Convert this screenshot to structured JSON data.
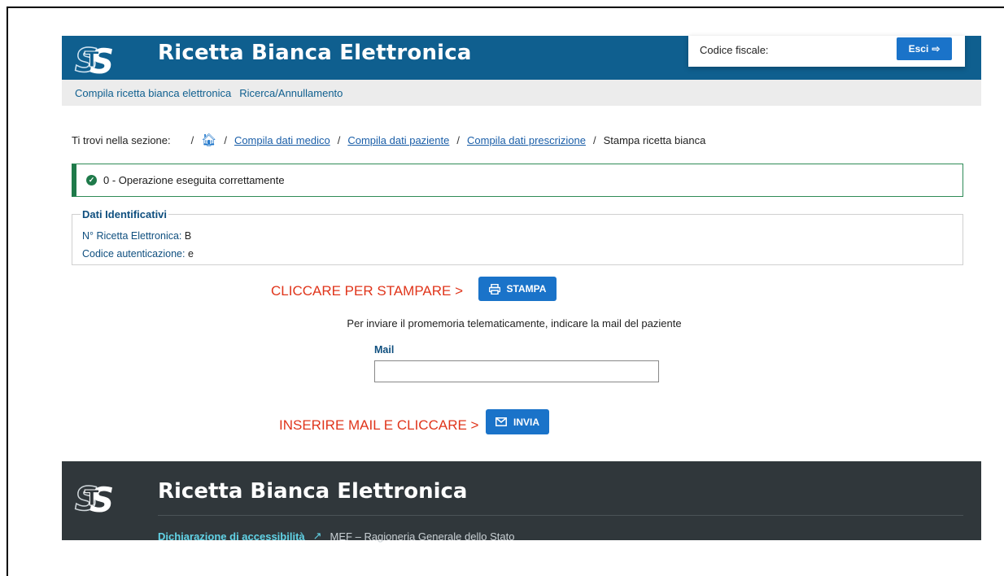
{
  "header": {
    "title": "Ricetta Bianca Elettronica",
    "codice_fiscale_label": "Codice fiscale:",
    "exit_label": "Esci"
  },
  "nav": {
    "items": [
      "Compila ricetta bianca elettronica",
      "Ricerca/Annullamento"
    ]
  },
  "breadcrumb": {
    "prefix": "Ti trovi nella sezione:",
    "items": [
      "Compila dati medico",
      "Compila dati paziente",
      "Compila dati prescrizione"
    ],
    "current": "Stampa ricetta bianca"
  },
  "alert": {
    "message": "0 - Operazione eseguita correttamente"
  },
  "dati": {
    "legend": "Dati Identificativi",
    "ricetta_label": "N° Ricetta Elettronica:",
    "ricetta_value": "B",
    "codice_label": "Codice autenticazione:",
    "codice_value": "e"
  },
  "print": {
    "annotation": "CLICCARE PER STAMPARE >",
    "button_label": "STAMPA"
  },
  "mail": {
    "instruction": "Per inviare il promemoria telematicamente, indicare la mail del paziente",
    "label": "Mail",
    "value": "",
    "placeholder": ""
  },
  "send": {
    "annotation": "INSERIRE MAIL E CLICCARE >",
    "button_label": "INVIA"
  },
  "footer": {
    "title": "Ricetta Bianca Elettronica",
    "accessibility_link": "Dichiarazione di accessibilità",
    "org": "MEF – Ragioneria Generale dello Stato"
  },
  "colors": {
    "header_bg": "#0f5f8f",
    "button": "#1a73c9",
    "success": "#1f7a4a",
    "annotation": "#e0351b",
    "footer_bg": "#30373b"
  }
}
